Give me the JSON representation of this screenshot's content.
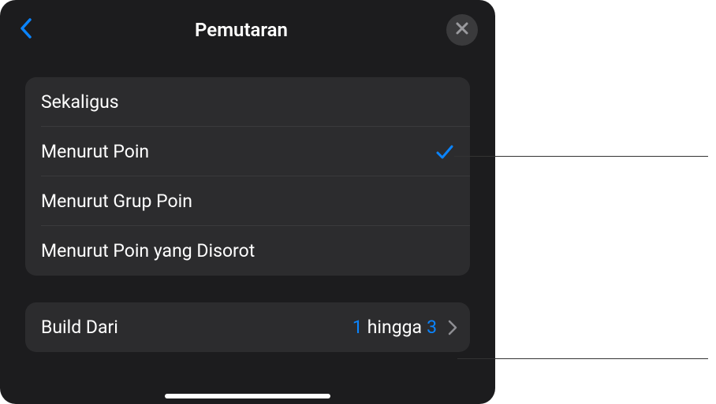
{
  "header": {
    "title": "Pemutaran"
  },
  "options": [
    {
      "label": "Sekaligus",
      "selected": false
    },
    {
      "label": "Menurut Poin",
      "selected": true
    },
    {
      "label": "Menurut Grup Poin",
      "selected": false
    },
    {
      "label": "Menurut Poin yang Disorot",
      "selected": false
    }
  ],
  "buildFrom": {
    "label": "Build Dari",
    "start": "1",
    "separator": "hingga",
    "end": "3"
  },
  "colors": {
    "accent": "#0a84ff",
    "checkmark": "#30d158",
    "background": "#1c1c1e",
    "groupBg": "#2c2c2e"
  }
}
